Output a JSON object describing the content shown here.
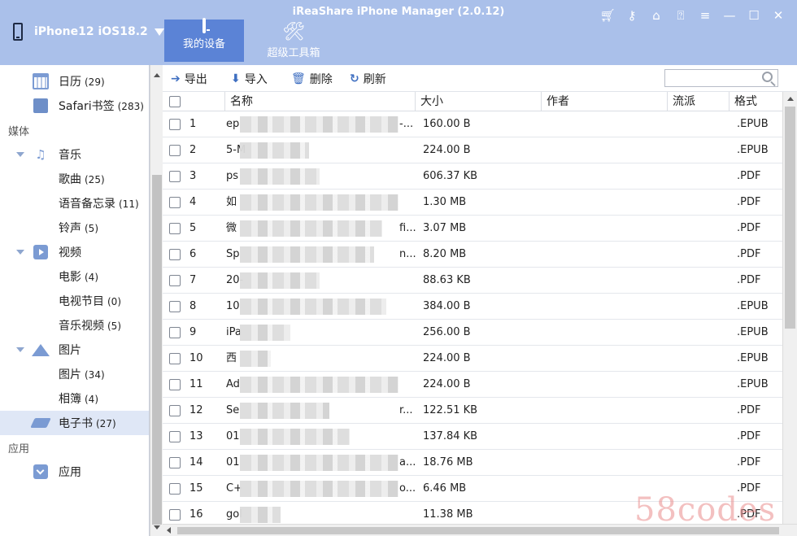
{
  "app": {
    "title": "iReaShare iPhone Manager (2.0.12)"
  },
  "device": {
    "name": "iPhone12 iOS18.2"
  },
  "nav": [
    {
      "label": "我的设备",
      "active": true
    },
    {
      "label": "超级工具箱",
      "active": false
    }
  ],
  "window_controls": {
    "cart": "cart-icon",
    "key": "key-icon",
    "home": "home-icon",
    "help": "help-icon",
    "menu": "≡",
    "minimize": "—",
    "maximize": "☐",
    "close": "✕"
  },
  "sidebar": {
    "items": [
      {
        "label": "日历",
        "count": "(29)",
        "icon": "calendar-icon"
      },
      {
        "label": "Safari书签",
        "count": "(283)",
        "icon": "bookmark-icon"
      },
      {
        "section": "媒体"
      },
      {
        "label": "音乐",
        "icon": "music-icon",
        "expandable": true
      },
      {
        "label": "歌曲",
        "count": "(25)"
      },
      {
        "label": "语音备忘录",
        "count": "(11)"
      },
      {
        "label": "铃声",
        "count": "(5)"
      },
      {
        "label": "视频",
        "icon": "video-icon",
        "expandable": true
      },
      {
        "label": "电影",
        "count": "(4)"
      },
      {
        "label": "电视节目",
        "count": "(0)"
      },
      {
        "label": "音乐视频",
        "count": "(5)"
      },
      {
        "label": "图片",
        "icon": "picture-icon",
        "expandable": true
      },
      {
        "label": "图片",
        "count": "(34)"
      },
      {
        "label": "相簿",
        "count": "(4)"
      },
      {
        "label": "电子书",
        "count": "(27)",
        "icon": "ebook-icon",
        "active": true
      },
      {
        "section": "应用"
      },
      {
        "label": "应用",
        "icon": "app-icon"
      }
    ]
  },
  "toolbar": {
    "export": "导出",
    "import": "导入",
    "delete": "删除",
    "refresh": "刷新",
    "search_placeholder": ""
  },
  "table": {
    "columns": {
      "name": "名称",
      "size": "大小",
      "author": "作者",
      "genre": "流派",
      "format": "格式"
    },
    "rows": [
      {
        "idx": "1",
        "name": "ep",
        "tail": "-...",
        "size": "160.00 B",
        "format": ".EPUB"
      },
      {
        "idx": "2",
        "name": "5-M",
        "tail": "",
        "size": "224.00 B",
        "format": ".EPUB"
      },
      {
        "idx": "3",
        "name": "ps",
        "tail": "",
        "size": "606.37 KB",
        "format": ".PDF"
      },
      {
        "idx": "4",
        "name": "如",
        "tail": "",
        "size": "1.30 MB",
        "format": ".PDF"
      },
      {
        "idx": "5",
        "name": "微",
        "tail": "fi...",
        "size": "3.07 MB",
        "format": ".PDF"
      },
      {
        "idx": "6",
        "name": "Sp",
        "tail": "n...",
        "size": "8.20 MB",
        "format": ".PDF"
      },
      {
        "idx": "7",
        "name": "20-",
        "tail": "",
        "size": "88.63 KB",
        "format": ".PDF"
      },
      {
        "idx": "8",
        "name": "10",
        "tail": "",
        "size": "384.00 B",
        "format": ".EPUB"
      },
      {
        "idx": "9",
        "name": "iPa",
        "tail": "",
        "size": "256.00 B",
        "format": ".EPUB"
      },
      {
        "idx": "10",
        "name": "西",
        "tail": "",
        "size": "224.00 B",
        "format": ".EPUB"
      },
      {
        "idx": "11",
        "name": "Ad",
        "tail": "",
        "size": "224.00 B",
        "format": ".EPUB"
      },
      {
        "idx": "12",
        "name": "Se",
        "tail": "r...",
        "size": "122.51 KB",
        "format": ".PDF"
      },
      {
        "idx": "13",
        "name": "01",
        "tail": "",
        "size": "137.84 KB",
        "format": ".PDF"
      },
      {
        "idx": "14",
        "name": "01",
        "tail": "a...",
        "size": "18.76 MB",
        "format": ".PDF"
      },
      {
        "idx": "15",
        "name": "C+",
        "tail": "o...",
        "size": "6.46 MB",
        "format": ".PDF"
      },
      {
        "idx": "16",
        "name": "gol",
        "tail": "",
        "size": "11.38 MB",
        "format": ".PDF"
      }
    ]
  },
  "watermark": "58codes"
}
